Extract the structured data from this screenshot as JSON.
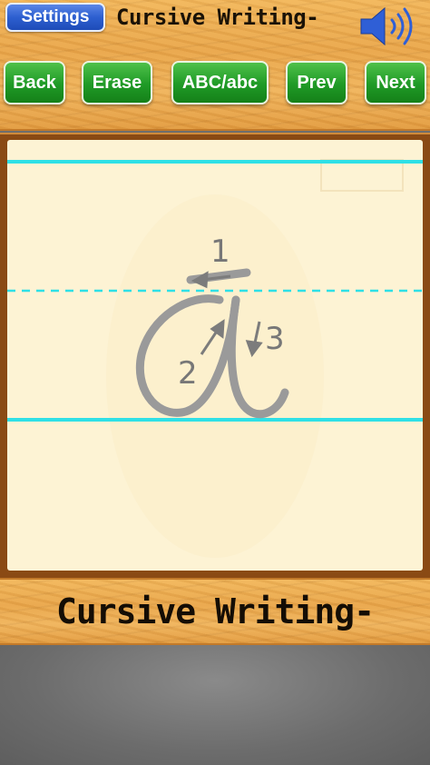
{
  "header": {
    "settings_label": "Settings",
    "title": "Cursive Writing-",
    "speaker_icon": "speaker-volume-icon"
  },
  "toolbar": {
    "back_label": "Back",
    "erase_label": "Erase",
    "case_label": "ABC/abc",
    "prev_label": "Prev",
    "next_label": "Next"
  },
  "board": {
    "letter": "a",
    "strokes": [
      {
        "number": "1",
        "direction": "left"
      },
      {
        "number": "2",
        "direction": "up-right"
      },
      {
        "number": "3",
        "direction": "down"
      }
    ]
  },
  "footer": {
    "title": "Cursive Writing-"
  },
  "colors": {
    "guide_line": "#2fe0e6",
    "letter_stroke": "#9a9a9a",
    "board_bg": "#fdf3d4",
    "green_button": "#1f9a26",
    "blue_button": "#2d5fd0"
  }
}
